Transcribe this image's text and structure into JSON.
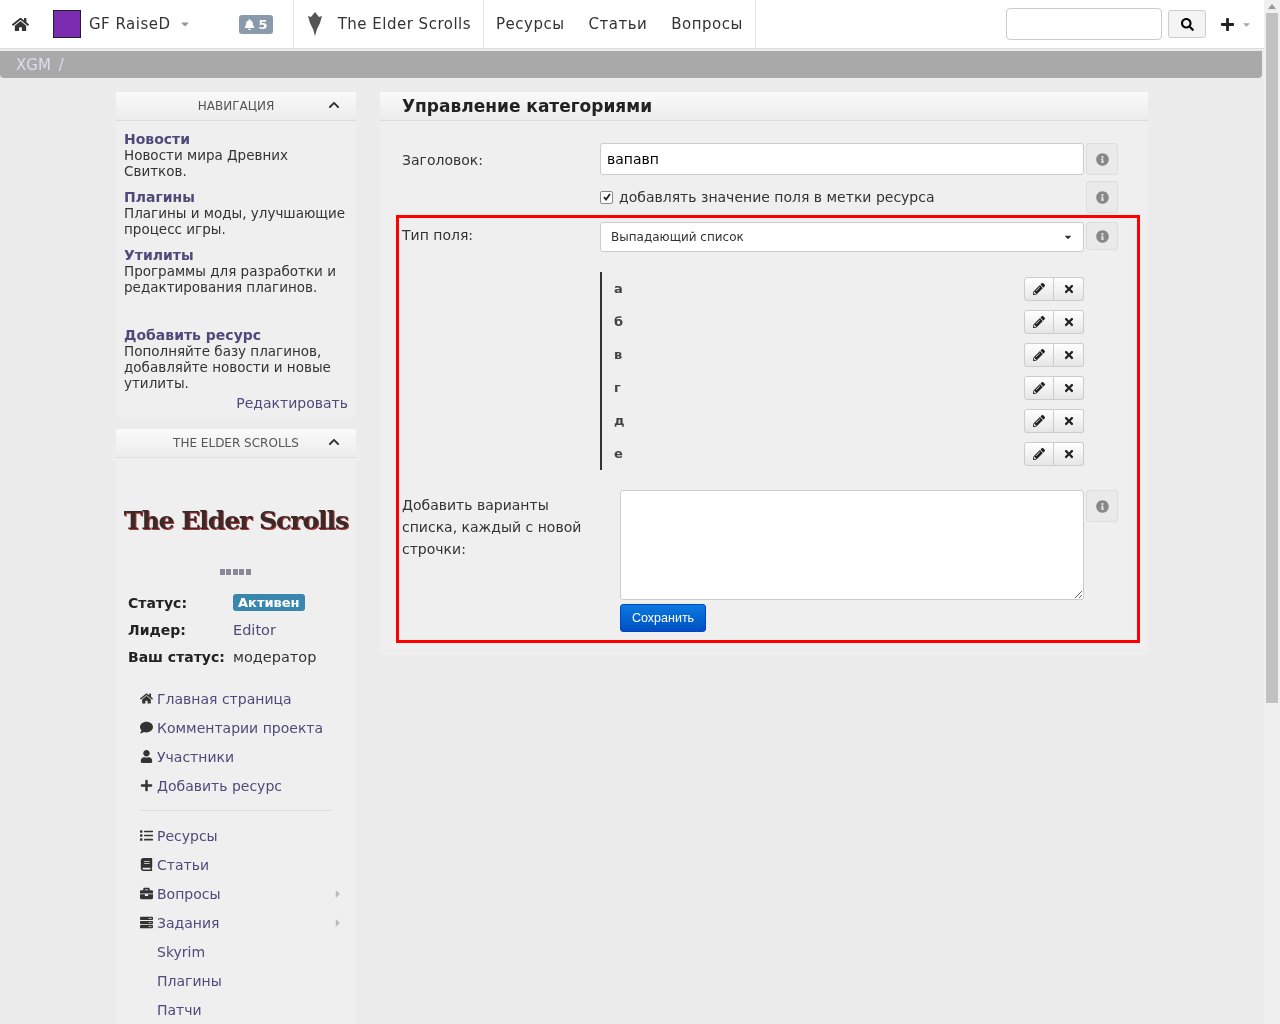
{
  "navbar": {
    "user": "GF RaiseD",
    "notifications": "5",
    "project": "The Elder Scrolls",
    "links": [
      "Ресурсы",
      "Статьи",
      "Вопросы"
    ]
  },
  "breadcrumb": [
    "XGM",
    "/"
  ],
  "sidebar": {
    "navigation": {
      "title": "НАВИГАЦИЯ",
      "expanded": true,
      "items": [
        {
          "title": "Новости",
          "text": "Новости мира Древних Свитков."
        },
        {
          "title": "Плагины",
          "text": "Плагины и моды, улучшающие процесс игры."
        },
        {
          "title": "Утилиты",
          "text": "Программы для разработки и редактирования плагинов."
        },
        {
          "title": "Добавить ресурс",
          "text": "Пополняйте базу плагинов, добавляйте новости и новые утилиты."
        }
      ],
      "edit_link": "Редактировать"
    },
    "project": {
      "title": "THE ELDER SCROLLS",
      "expanded": true,
      "logo_text": "The Elder Scrolls",
      "info": [
        {
          "label": "Статус:",
          "value": "Активен",
          "kind": "badge"
        },
        {
          "label": "Лидер:",
          "value": "Editor",
          "kind": "link"
        },
        {
          "label": "Ваш статус:",
          "value": "модератор",
          "kind": "text"
        }
      ],
      "links": [
        "Главная страница",
        "Комментарии проекта",
        "Участники",
        "Добавить ресурс"
      ],
      "sections": [
        {
          "label": "Ресурсы",
          "has_submenu": false
        },
        {
          "label": "Статьи",
          "has_submenu": false
        },
        {
          "label": "Вопросы",
          "has_submenu": true
        },
        {
          "label": "Задания",
          "has_submenu": true
        },
        {
          "label": "Skyrim",
          "has_submenu": false
        },
        {
          "label": "Плагины",
          "has_submenu": false
        },
        {
          "label": "Патчи",
          "has_submenu": false
        }
      ]
    }
  },
  "form": {
    "title": "Управление категориями",
    "heading_label": "Заголовок:",
    "heading_value": "вапавп",
    "tags_checkbox": {
      "label": "добавлять значение поля в метки ресурса",
      "checked": true
    },
    "type_label": "Тип поля:",
    "type_value": "Выпадающий список",
    "highlighted": true,
    "options": [
      "а",
      "б",
      "в",
      "г",
      "д",
      "е"
    ],
    "add_label": "Добавить варианты списка, каждый с новой строчки:",
    "save": "Сохранить"
  }
}
